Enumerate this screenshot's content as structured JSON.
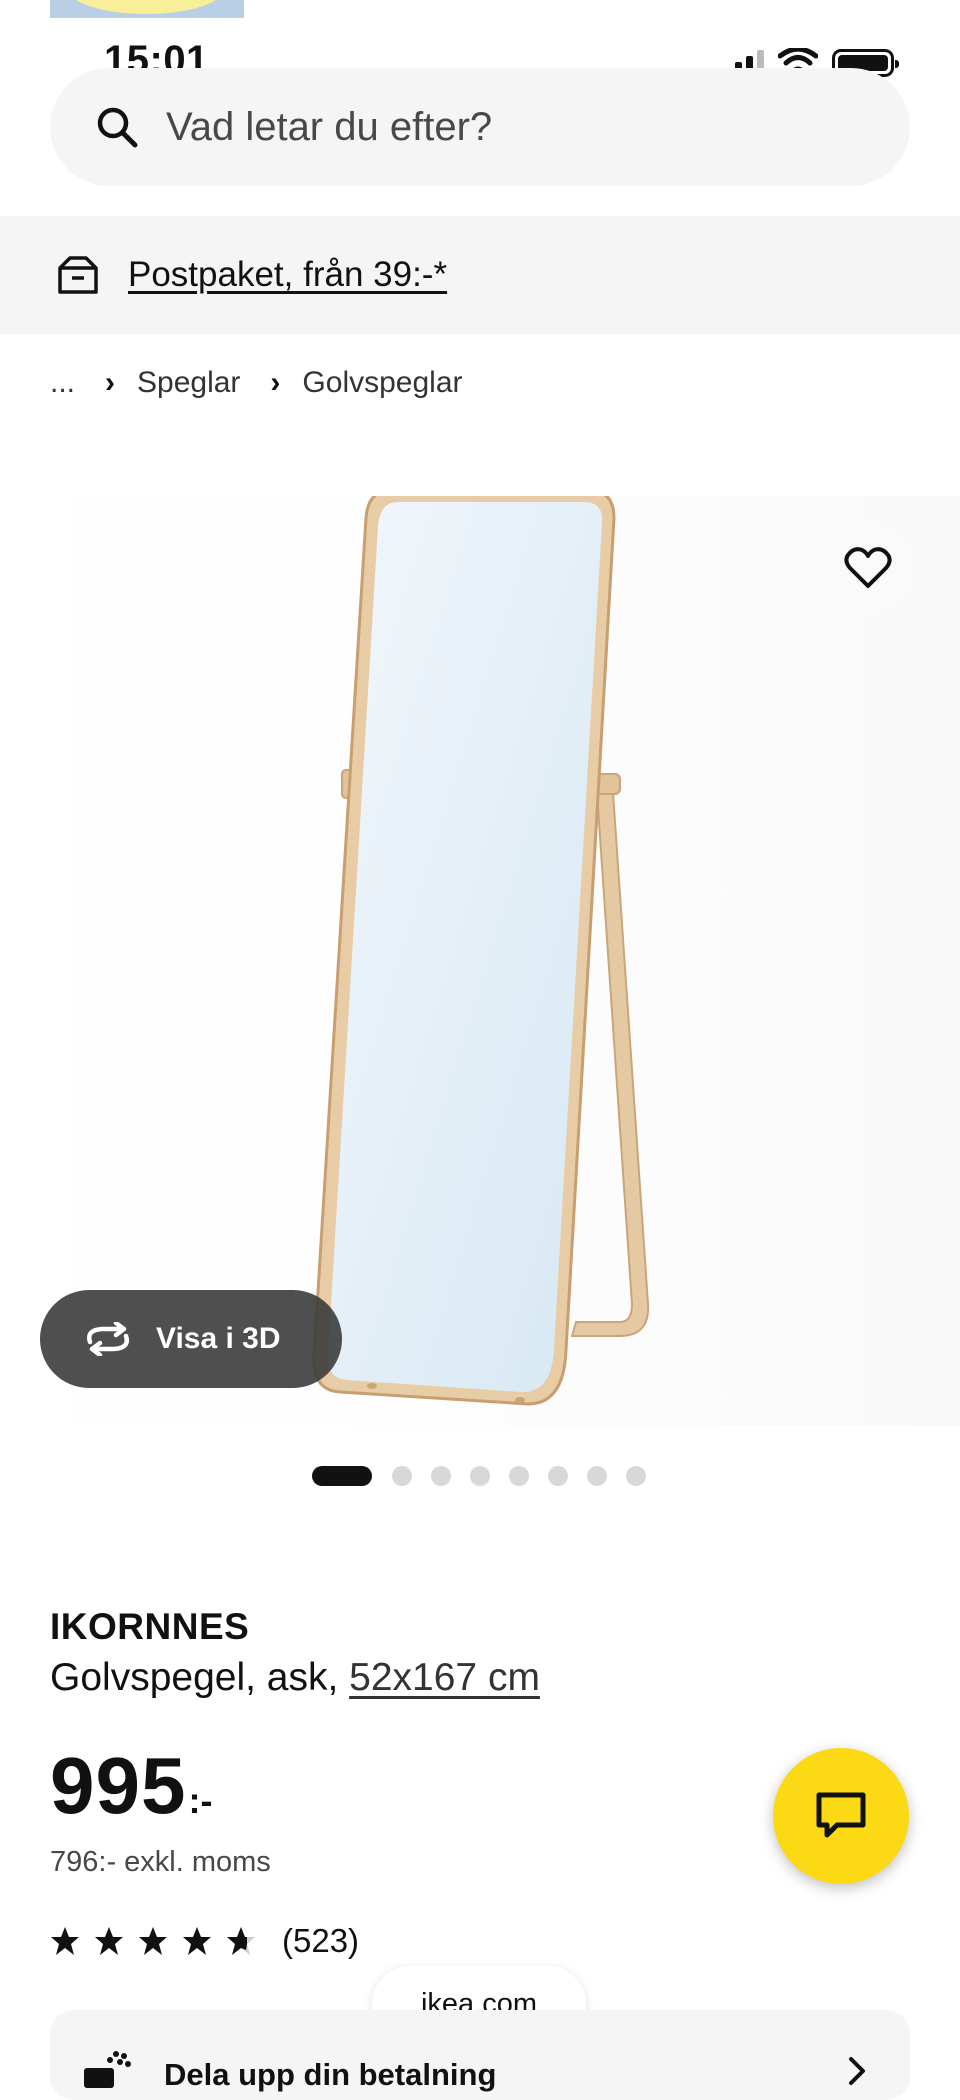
{
  "status_bar": {
    "time": "15:01"
  },
  "search": {
    "placeholder": "Vad letar du efter?"
  },
  "banner": {
    "text": "Postpaket, från 39:-*"
  },
  "breadcrumb": {
    "ellipsis": "...",
    "items": [
      "Speglar",
      "Golvspeglar"
    ]
  },
  "gallery": {
    "view_3d_label": "Visa i 3D",
    "image_count": 8,
    "active_index": 0
  },
  "product": {
    "name": "IKORNNES",
    "description": "Golvspegel, ask, ",
    "size": "52x167 cm",
    "price": "995",
    "currency": ":-",
    "price_excl_vat": "796:- exkl. moms",
    "rating": 4.5,
    "review_count": "(523)"
  },
  "browser": {
    "url": "ikea.com"
  },
  "payment": {
    "label": "Dela upp din betalning"
  },
  "colors": {
    "chat_button": "#fbd914",
    "text": "#111111",
    "muted": "#484848",
    "surface": "#f5f5f5"
  }
}
